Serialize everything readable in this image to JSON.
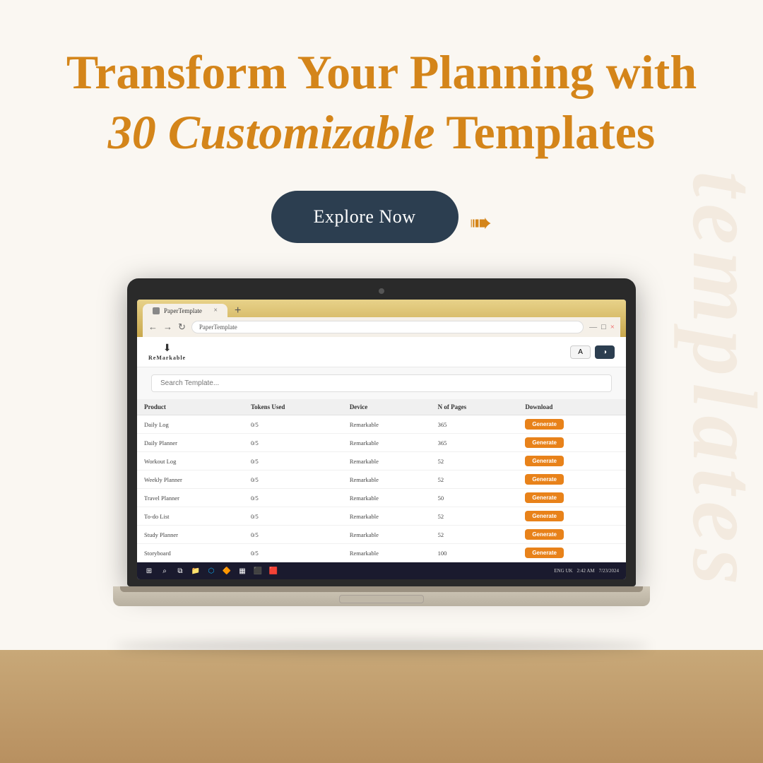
{
  "background": {
    "bg_color": "#faf7f2",
    "watermark_text": "templates"
  },
  "headline": {
    "line1": "Transform Your Planning with",
    "line2_italic": "30 Customizable",
    "line2_normal": " Templates"
  },
  "cta": {
    "button_label": "Explore Now"
  },
  "browser": {
    "tab_label": "PaperTemplate",
    "tab_new": "+",
    "nav_back": "←",
    "nav_forward": "→",
    "nav_refresh": "↻",
    "address": "PaperTemplate",
    "minimize": "—",
    "maximize": "□",
    "close": "×"
  },
  "app": {
    "logo_text": "ReMarkable",
    "search_placeholder": "Search Template...",
    "btn_a": "A",
    "btn_dark": "◑",
    "table": {
      "headers": [
        "Product",
        "Tokens Used",
        "Device",
        "N of Pages",
        "Download"
      ],
      "rows": [
        [
          "Daily Log",
          "0/5",
          "Remarkable",
          "365",
          "Generate"
        ],
        [
          "Daily Planner",
          "0/5",
          "Remarkable",
          "365",
          "Generate"
        ],
        [
          "Workout Log",
          "0/5",
          "Remarkable",
          "52",
          "Generate"
        ],
        [
          "Weekly Planner",
          "0/5",
          "Remarkable",
          "52",
          "Generate"
        ],
        [
          "Travel Planner",
          "0/5",
          "Remarkable",
          "50",
          "Generate"
        ],
        [
          "To-do List",
          "0/5",
          "Remarkable",
          "52",
          "Generate"
        ],
        [
          "Study Planner",
          "0/5",
          "Remarkable",
          "52",
          "Generate"
        ],
        [
          "Storyboard",
          "0/5",
          "Remarkable",
          "100",
          "Generate"
        ]
      ]
    }
  },
  "taskbar": {
    "time": "2:42 AM",
    "date": "7/23/2024",
    "lang": "ENG UK"
  },
  "desk": {
    "color": "#c8a878"
  }
}
